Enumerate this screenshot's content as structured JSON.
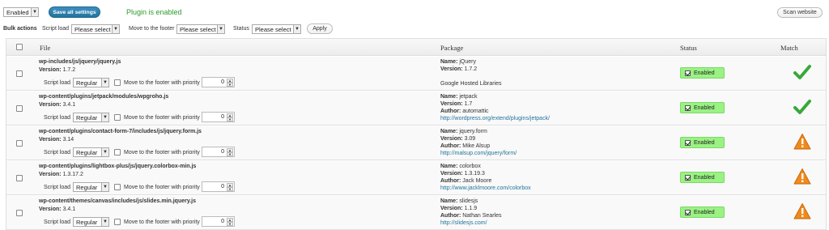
{
  "topbar": {
    "enabled_select": "Enabled",
    "save_label": "Save all settings",
    "status_message": "Plugin is enabled",
    "scan_label": "Scan website"
  },
  "bulk": {
    "label": "Bulk actions",
    "script_load_label": "Script load",
    "script_load_value": "Please select",
    "move_footer_label": "Move to the footer",
    "move_footer_value": "Please select",
    "status_label": "Status",
    "status_value": "Please select",
    "apply_label": "Apply"
  },
  "table": {
    "headers": {
      "file": "File",
      "package": "Package",
      "status": "Status",
      "match": "Match"
    },
    "row_labels": {
      "version": "Version:",
      "script_load": "Script load",
      "move_footer": "Move to the footer with priority",
      "name": "Name:",
      "pkg_version": "Version:",
      "author": "Author:"
    },
    "rows": [
      {
        "file": "wp-includes/js/jquery/jquery.js",
        "version": "1.7.2",
        "script_load": "Regular",
        "priority": "0",
        "pkg_name": "jQuery",
        "pkg_version": "1.7.2",
        "pkg_author": "",
        "pkg_url": "",
        "pkg_extra": "Google Hosted Libraries",
        "status": "Enabled",
        "match": "check"
      },
      {
        "file": "wp-content/plugins/jetpack/modules/wpgroho.js",
        "version": "3.4.1",
        "script_load": "Regular",
        "priority": "0",
        "pkg_name": "jetpack",
        "pkg_version": "1.7",
        "pkg_author": "automattic",
        "pkg_url": "http://wordpress.org/extend/plugins/jetpack/",
        "pkg_extra": "",
        "status": "Enabled",
        "match": "check"
      },
      {
        "file": "wp-content/plugins/contact-form-7/includes/js/jquery.form.js",
        "version": "3.14",
        "script_load": "Regular",
        "priority": "0",
        "pkg_name": "jquery.form",
        "pkg_version": "3.09",
        "pkg_author": "Mike Alsup",
        "pkg_url": "http://malsup.com/jquery/form/",
        "pkg_extra": "",
        "status": "Enabled",
        "match": "warning"
      },
      {
        "file": "wp-content/plugins/lightbox-plus/js/jquery.colorbox-min.js",
        "version": "1.3.17.2",
        "script_load": "Regular",
        "priority": "0",
        "pkg_name": "colorbox",
        "pkg_version": "1.3.19.3",
        "pkg_author": "Jack Moore",
        "pkg_url": "http://www.jacklmoore.com/colorbox",
        "pkg_extra": "",
        "status": "Enabled",
        "match": "warning"
      },
      {
        "file": "wp-content/themes/canvas/includes/js/slides.min.jquery.js",
        "version": "3.4.1",
        "script_load": "Regular",
        "priority": "0",
        "pkg_name": "slidesjs",
        "pkg_version": "1.1.9",
        "pkg_author": "Nathan Searles",
        "pkg_url": "http://slidesjs.com/",
        "pkg_extra": "",
        "status": "Enabled",
        "match": "warning"
      }
    ]
  },
  "colors": {
    "status_green": "#9af283",
    "match_check": "#3aa83a",
    "match_warning": "#f08a1c",
    "link": "#21759b"
  }
}
